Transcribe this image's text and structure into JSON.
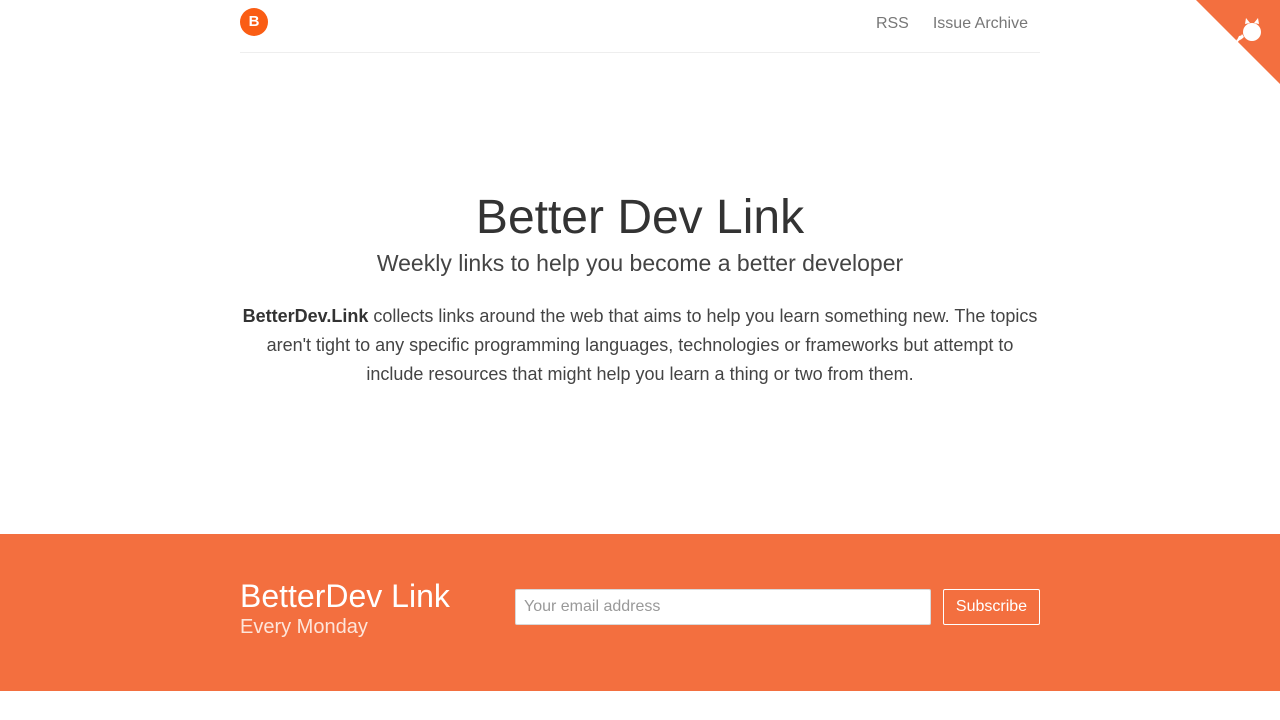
{
  "header": {
    "logo_letter": "B",
    "nav": [
      {
        "label": "RSS"
      },
      {
        "label": "Issue Archive"
      }
    ]
  },
  "hero": {
    "title": "Better Dev Link",
    "subtitle": "Weekly links to help you become a better developer",
    "desc_strong": "BetterDev.Link",
    "desc_rest": " collects links around the web that aims to help you learn something new. The topics aren't tight to any specific programming languages, technologies or frameworks but attempt to include resources that might help you learn a thing or two from them."
  },
  "subscribe": {
    "title": "BetterDev Link",
    "subtitle": "Every Monday",
    "email_placeholder": "Your email address",
    "button_label": "Subscribe"
  },
  "colors": {
    "accent": "#f36f3f",
    "logo": "#fa5d14"
  },
  "icons": {
    "github_corner": "github-octocat-icon"
  }
}
